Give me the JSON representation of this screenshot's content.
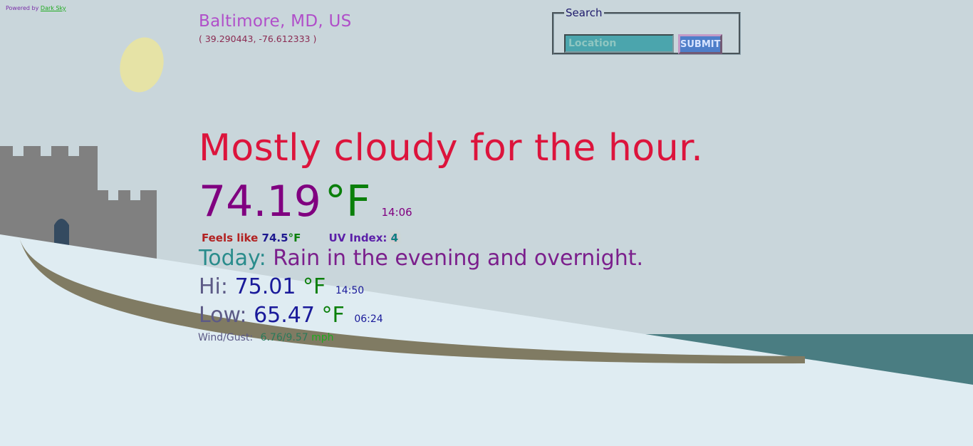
{
  "attribution": {
    "prefix": "Powered by",
    "link_text": "Dark Sky"
  },
  "location": {
    "name": "Baltimore, MD, US",
    "coordinates": "( 39.290443, -76.612333 )"
  },
  "search": {
    "legend": "Search",
    "placeholder": "Location",
    "value": "",
    "submit_label": "SUBMIT"
  },
  "current": {
    "summary": "Mostly cloudy for the hour.",
    "temperature": "74.19",
    "unit": "°F",
    "time": "14:06",
    "feels_like_label": "Feels like",
    "feels_like_value": "74.5",
    "feels_like_unit": "°F",
    "uv_label": "UV Index:",
    "uv_value": "4"
  },
  "today": {
    "label": "Today:",
    "summary": "Rain in the evening and overnight.",
    "hi_label": "Hi:",
    "hi_value": "75.01",
    "hi_unit": "°F",
    "hi_time": "14:50",
    "low_label": "Low:",
    "low_value": "65.47",
    "low_unit": "°F",
    "low_time": "06:24",
    "wind_label": "Wind/Gust:",
    "wind_value": "6.76/9.57",
    "wind_unit": "mph"
  },
  "colors": {
    "sky": "#c9d6db",
    "snow": "#dfecf2",
    "sea": "#4a7d82",
    "moon": "#e6e3a6",
    "castle": "#808080",
    "path": "#807b63"
  }
}
